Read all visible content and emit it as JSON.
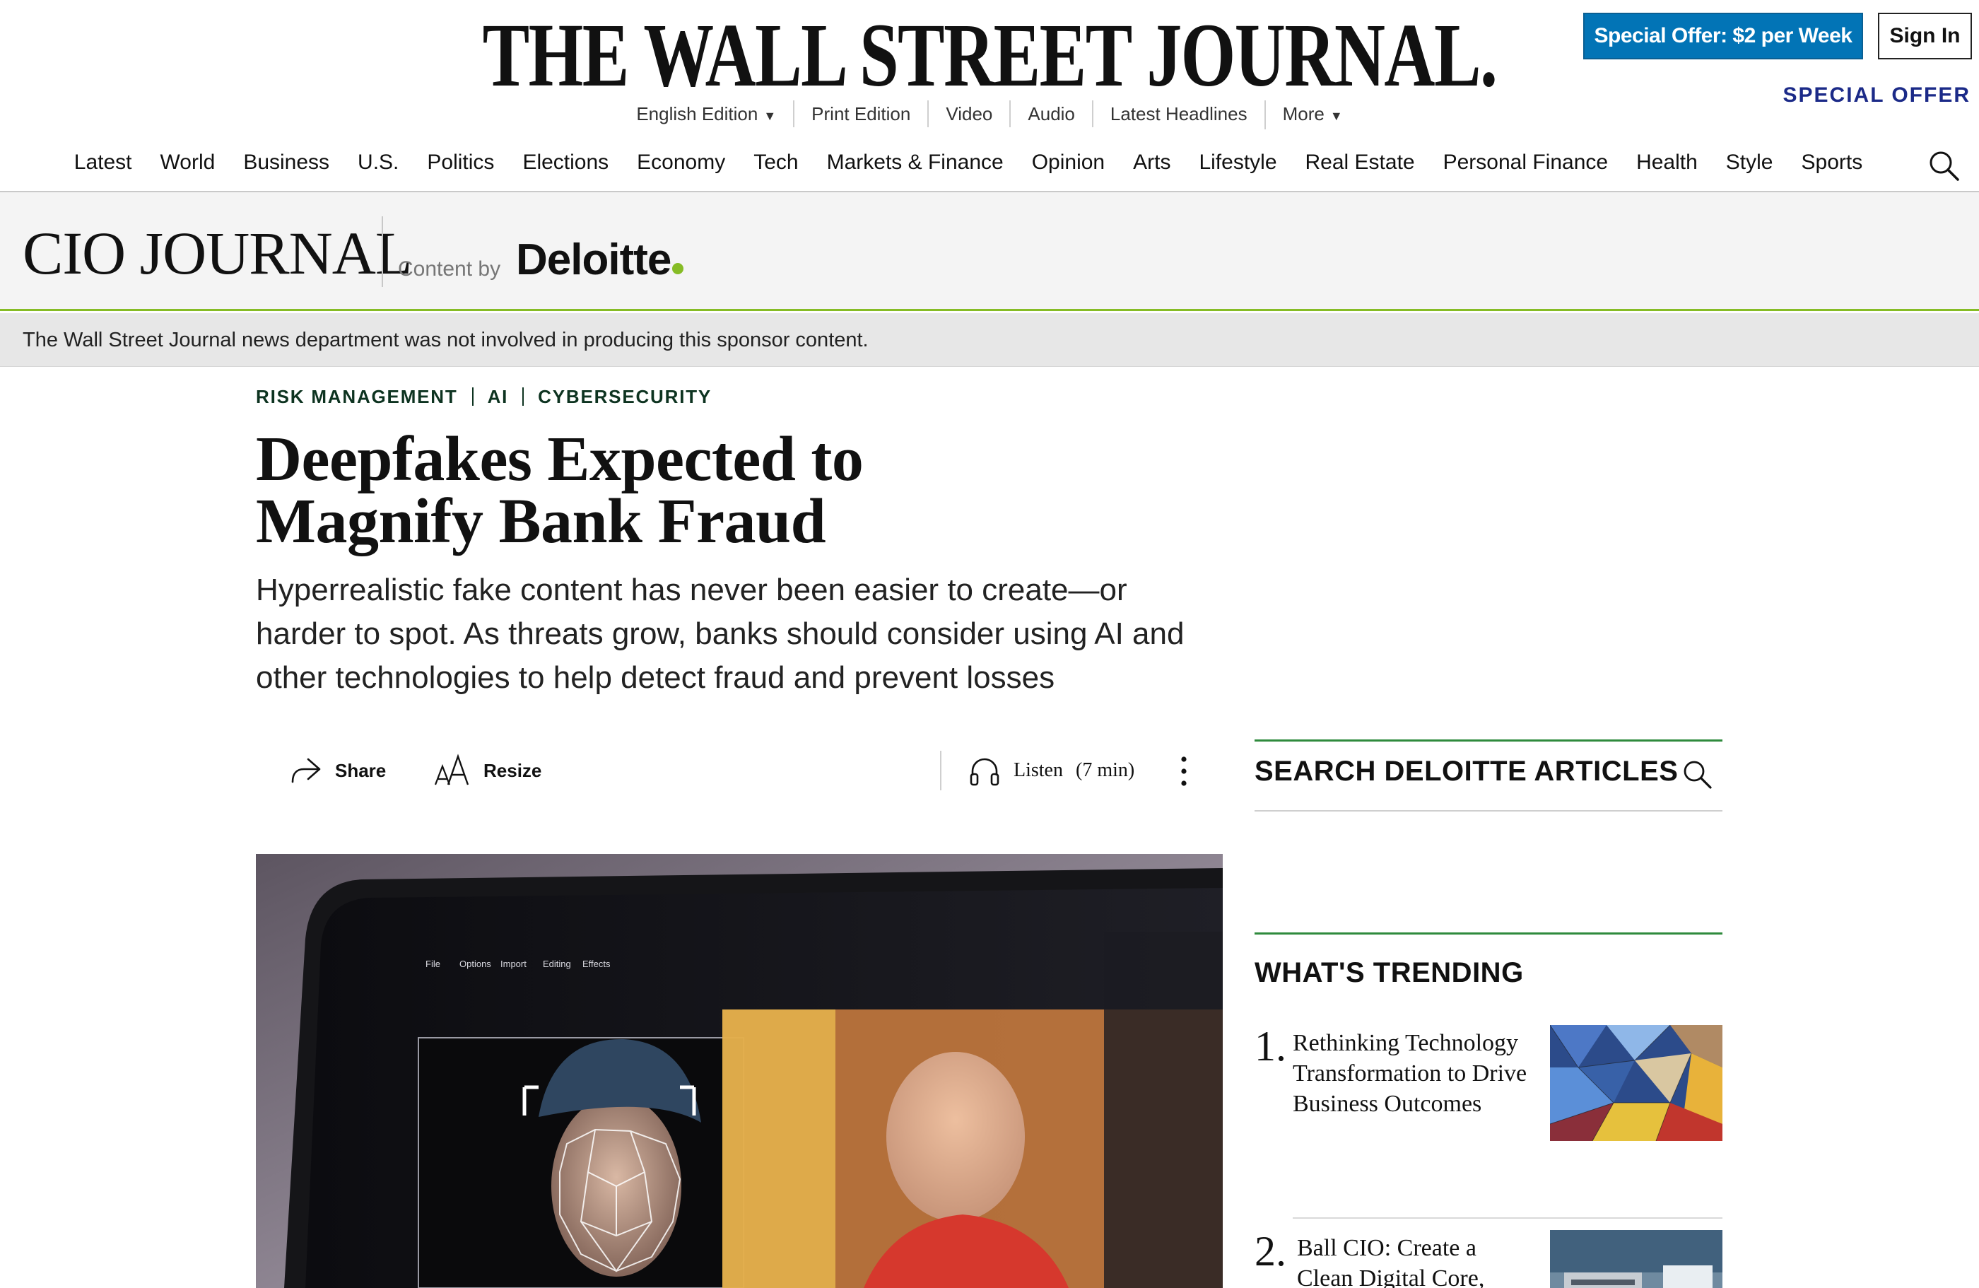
{
  "masthead": {
    "logo": "THE WALL STREET JOURNAL.",
    "edition": "English Edition",
    "links": [
      "Print Edition",
      "Video",
      "Audio",
      "Latest Headlines"
    ],
    "more": "More",
    "offer_button": "Special Offer: $2 per Week",
    "signin_button": "Sign In",
    "special_offer_link": "SPECIAL OFFER"
  },
  "nav": {
    "items": [
      "Latest",
      "World",
      "Business",
      "U.S.",
      "Politics",
      "Elections",
      "Economy",
      "Tech",
      "Markets & Finance",
      "Opinion",
      "Arts",
      "Lifestyle",
      "Real Estate",
      "Personal Finance",
      "Health",
      "Style",
      "Sports"
    ]
  },
  "sponsor": {
    "section_logo": "CIO JOURNAL",
    "content_by": "Content by",
    "sponsor_name": "Deloitte",
    "disclaimer": "The Wall Street Journal news department was not involved in producing this sponsor content."
  },
  "article": {
    "tags": [
      "RISK MANAGEMENT",
      "AI",
      "CYBERSECURITY"
    ],
    "headline_line1": "Deepfakes Expected to",
    "headline_line2": "Magnify Bank Fraud",
    "dek": "Hyperrealistic fake content has never been easier to create—or harder to spot. As threats grow, banks should consider using AI and other technologies to help detect fraud and prevent losses",
    "share_label": "Share",
    "resize_label": "Resize",
    "listen_label": "Listen",
    "listen_duration": "(7 min)",
    "hero_menu": [
      "File",
      "Options",
      "Import",
      "Editing",
      "Effects"
    ]
  },
  "sidebar": {
    "search_label": "SEARCH DELOITTE ARTICLES",
    "trending_title": "WHAT'S TRENDING",
    "trending": [
      {
        "rank": "1.",
        "title": "Rethinking Technology Transformation to Drive Business Outcomes"
      },
      {
        "rank": "2.",
        "title": "Ball CIO: Create a Clean Digital Core, Customize at the Edge"
      }
    ]
  },
  "colors": {
    "offer_blue": "#0274b6",
    "special_offer": "#1b2a88",
    "deloitte_green": "#86bc25",
    "tag_green": "#0d3320",
    "sidebar_rule": "#2f8a3d"
  }
}
